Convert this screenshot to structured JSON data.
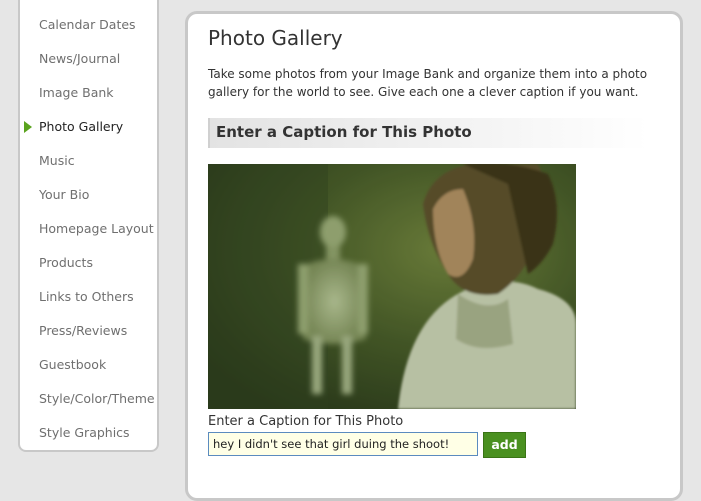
{
  "sidebar": {
    "items": [
      {
        "label": "Calendar Dates"
      },
      {
        "label": "News/Journal"
      },
      {
        "label": "Image Bank"
      },
      {
        "label": "Photo Gallery"
      },
      {
        "label": "Music"
      },
      {
        "label": "Your Bio"
      },
      {
        "label": "Homepage Layout"
      },
      {
        "label": "Products"
      },
      {
        "label": "Links to Others"
      },
      {
        "label": "Press/Reviews"
      },
      {
        "label": "Guestbook"
      },
      {
        "label": "Style/Color/Theme"
      },
      {
        "label": "Style Graphics"
      }
    ],
    "active_index": 3,
    "active_icon": "triangle-right-icon"
  },
  "main": {
    "title": "Photo Gallery",
    "description": "Take some photos from your Image Bank and organize them into a photo gallery for the world to see. Give each one a clever caption if you want.",
    "section_header": "Enter a Caption for This Photo",
    "caption_label": "Enter a Caption for This Photo",
    "caption_value": "hey I didn't see that girl duing the shoot!",
    "add_label": "add"
  },
  "colors": {
    "accent_green": "#4a9020",
    "input_background": "#ffffe6",
    "page_background": "#e6e6e6"
  }
}
